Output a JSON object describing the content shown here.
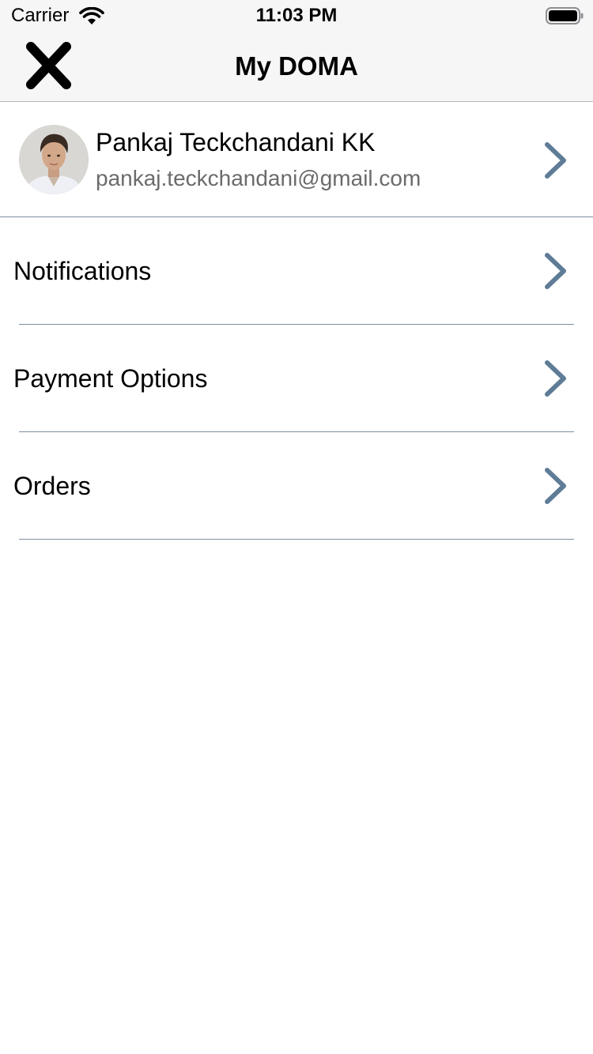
{
  "status_bar": {
    "carrier": "Carrier",
    "time": "11:03 PM",
    "wifi_icon": "wifi-icon",
    "battery_icon": "battery-icon"
  },
  "nav": {
    "title": "My DOMA",
    "close_icon": "close-icon"
  },
  "profile": {
    "name": "Pankaj Teckchandani KK",
    "email": "pankaj.teckchandani@gmail.com",
    "avatar_icon": "avatar",
    "chevron_icon": "chevron-right-icon"
  },
  "menu": {
    "items": [
      {
        "label": "Notifications"
      },
      {
        "label": "Payment Options"
      },
      {
        "label": "Orders"
      }
    ],
    "chevron_icon": "chevron-right-icon"
  },
  "colors": {
    "accent": "#5f7c97",
    "divider": "#7d8ea0",
    "nav_background": "#f6f6f6",
    "secondary_text": "#6b6b6b"
  }
}
